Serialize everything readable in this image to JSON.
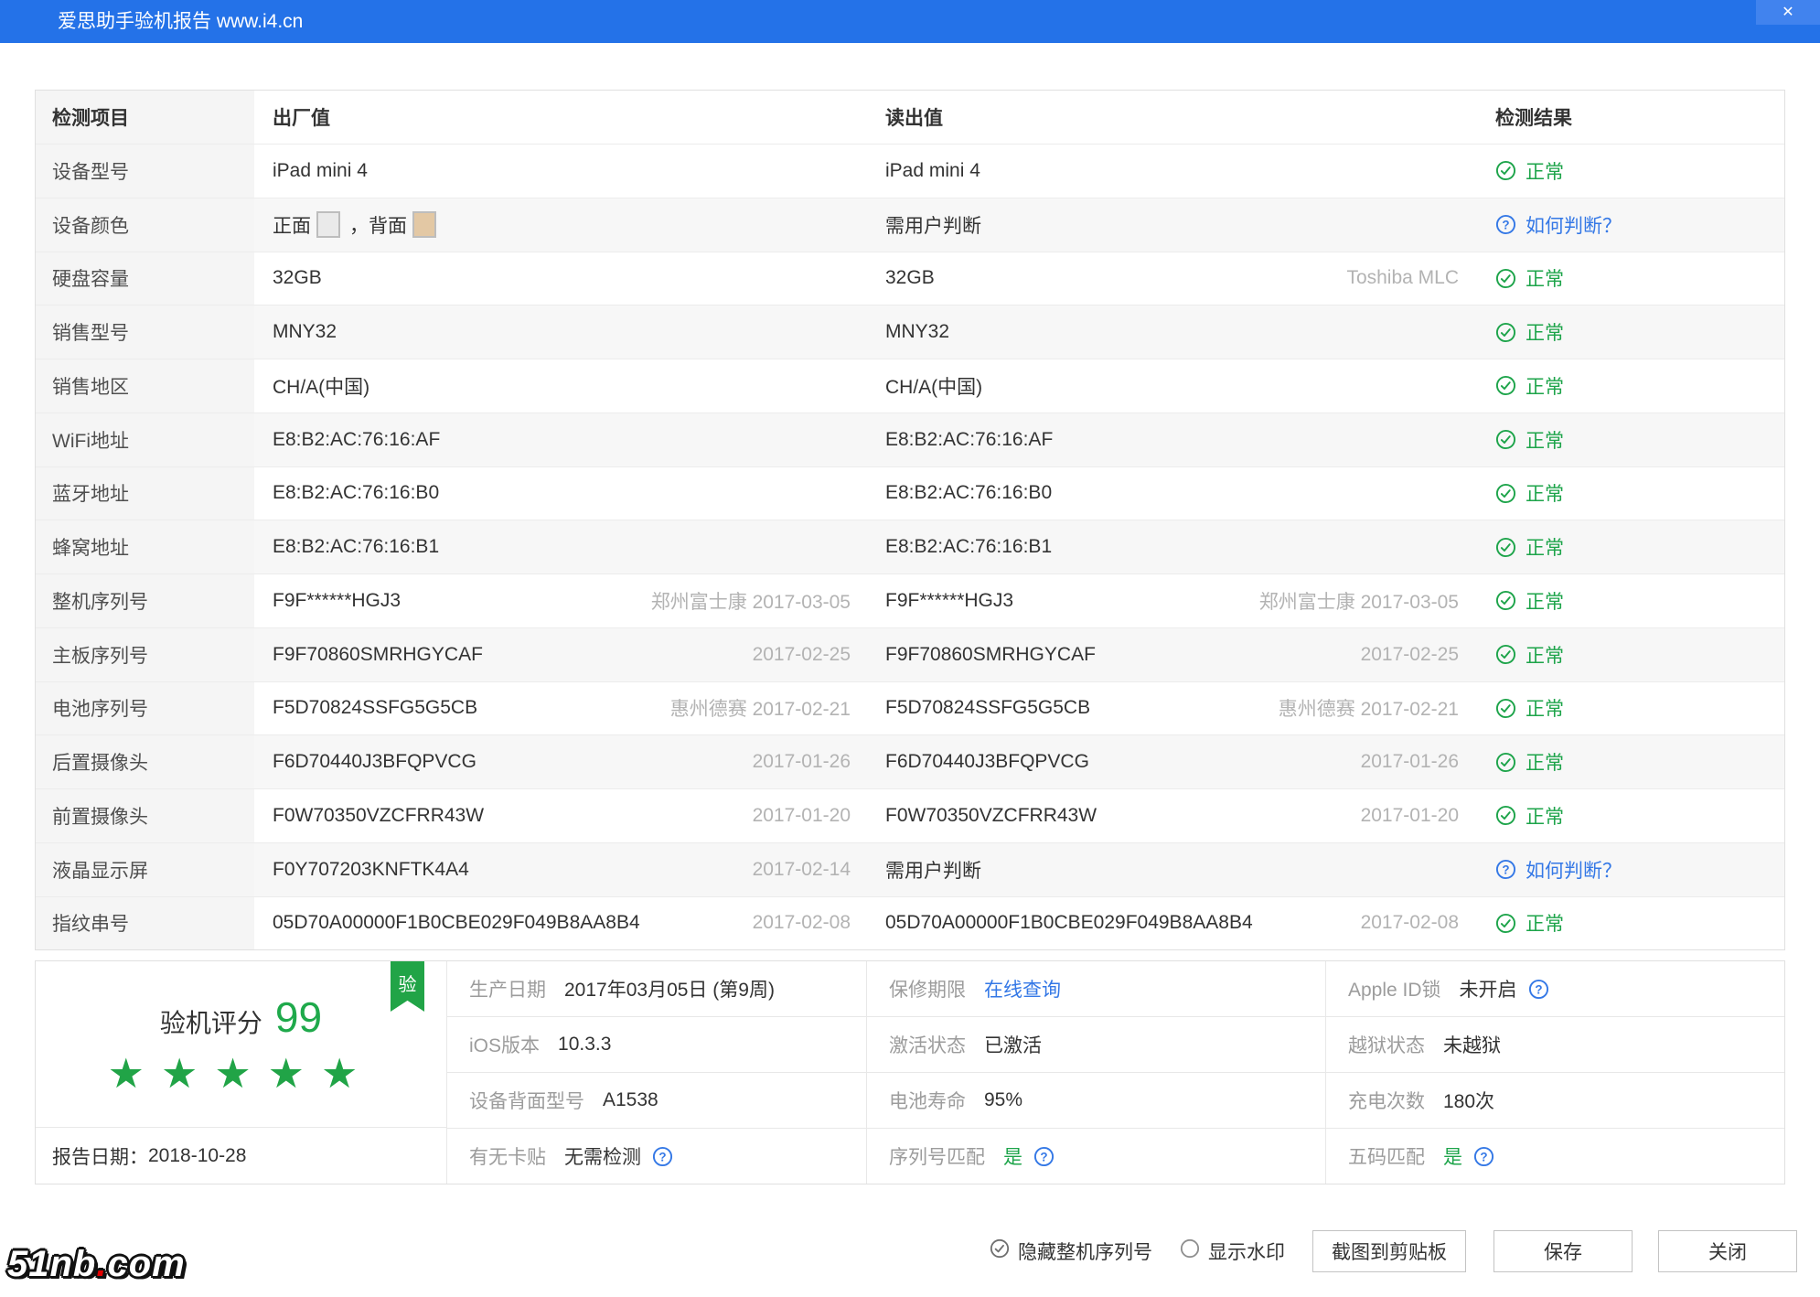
{
  "titlebar": {
    "title": "爱思助手验机报告 www.i4.cn",
    "close": "✕"
  },
  "table": {
    "headers": [
      "检测项目",
      "出厂值",
      "读出值",
      "检测结果"
    ],
    "result_labels": {
      "ok": "正常",
      "help": "如何判断？"
    },
    "rows": [
      {
        "item": "设备型号",
        "factory": {
          "text": "iPad mini 4"
        },
        "read": {
          "text": "iPad mini 4"
        },
        "result": "ok"
      },
      {
        "item": "设备颜色",
        "factory": {
          "swatches": [
            {
              "label": "正面",
              "color": "#eaeaea"
            },
            {
              "label": "，背面",
              "color": "#e3c8a4"
            }
          ]
        },
        "read": {
          "text": "需用户判断"
        },
        "result": "help"
      },
      {
        "item": "硬盘容量",
        "factory": {
          "text": "32GB"
        },
        "read": {
          "text": "32GB",
          "note": "Toshiba MLC"
        },
        "result": "ok"
      },
      {
        "item": "销售型号",
        "factory": {
          "text": "MNY32"
        },
        "read": {
          "text": "MNY32"
        },
        "result": "ok"
      },
      {
        "item": "销售地区",
        "factory": {
          "text": "CH/A(中国)"
        },
        "read": {
          "text": "CH/A(中国)"
        },
        "result": "ok"
      },
      {
        "item": "WiFi地址",
        "factory": {
          "text": "E8:B2:AC:76:16:AF"
        },
        "read": {
          "text": "E8:B2:AC:76:16:AF"
        },
        "result": "ok"
      },
      {
        "item": "蓝牙地址",
        "factory": {
          "text": "E8:B2:AC:76:16:B0"
        },
        "read": {
          "text": "E8:B2:AC:76:16:B0"
        },
        "result": "ok"
      },
      {
        "item": "蜂窝地址",
        "factory": {
          "text": "E8:B2:AC:76:16:B1"
        },
        "read": {
          "text": "E8:B2:AC:76:16:B1"
        },
        "result": "ok"
      },
      {
        "item": "整机序列号",
        "factory": {
          "text": "F9F******HGJ3",
          "note": "郑州富士康 2017-03-05"
        },
        "read": {
          "text": "F9F******HGJ3",
          "note": "郑州富士康 2017-03-05"
        },
        "result": "ok"
      },
      {
        "item": "主板序列号",
        "factory": {
          "text": "F9F70860SMRHGYCAF",
          "note": "2017-02-25"
        },
        "read": {
          "text": "F9F70860SMRHGYCAF",
          "note": "2017-02-25"
        },
        "result": "ok"
      },
      {
        "item": "电池序列号",
        "factory": {
          "text": "F5D70824SSFG5G5CB",
          "note": "惠州德赛 2017-02-21"
        },
        "read": {
          "text": "F5D70824SSFG5G5CB",
          "note": "惠州德赛 2017-02-21"
        },
        "result": "ok"
      },
      {
        "item": "后置摄像头",
        "factory": {
          "text": "F6D70440J3BFQPVCG",
          "note": "2017-01-26"
        },
        "read": {
          "text": "F6D70440J3BFQPVCG",
          "note": "2017-01-26"
        },
        "result": "ok"
      },
      {
        "item": "前置摄像头",
        "factory": {
          "text": "F0W70350VZCFRR43W",
          "note": "2017-01-20"
        },
        "read": {
          "text": "F0W70350VZCFRR43W",
          "note": "2017-01-20"
        },
        "result": "ok"
      },
      {
        "item": "液晶显示屏",
        "factory": {
          "text": "F0Y707203KNFTK4A4",
          "note": "2017-02-14"
        },
        "read": {
          "text": "需用户判断"
        },
        "result": "help"
      },
      {
        "item": "指纹串号",
        "factory": {
          "text": "05D70A00000F1B0CBE029F049B8AA8B4",
          "note": "2017-02-08"
        },
        "read": {
          "text": "05D70A00000F1B0CBE029F049B8AA8B4",
          "note": "2017-02-08"
        },
        "result": "ok"
      }
    ]
  },
  "score_panel": {
    "badge": "验",
    "score_label": "验机评分",
    "score": "99",
    "stars": 5,
    "star_char": "★",
    "report_date_label": "报告日期：",
    "report_date": "2018-10-28"
  },
  "info": {
    "columns": [
      {
        "cells": [
          {
            "label": "生产日期",
            "value": "2017年03月05日 (第9周)"
          },
          {
            "label": "iOS版本",
            "value": "10.3.3"
          },
          {
            "label": "设备背面型号",
            "value": "A1538"
          },
          {
            "label": "有无卡贴",
            "value": "无需检测",
            "help": true
          }
        ]
      },
      {
        "cells": [
          {
            "label": "保修期限",
            "value": "在线查询",
            "style": "link"
          },
          {
            "label": "激活状态",
            "value": "已激活"
          },
          {
            "label": "电池寿命",
            "value": "95%"
          },
          {
            "label": "序列号匹配",
            "value": "是",
            "style": "green",
            "help": true
          }
        ]
      },
      {
        "cells": [
          {
            "label": "Apple ID锁",
            "value": "未开启",
            "help": true
          },
          {
            "label": "越狱状态",
            "value": "未越狱"
          },
          {
            "label": "充电次数",
            "value": "180次"
          },
          {
            "label": "五码匹配",
            "value": "是",
            "style": "green",
            "help": true
          }
        ]
      }
    ]
  },
  "footer": {
    "hide_serial_label": "隐藏整机序列号",
    "show_watermark_label": "显示水印",
    "screenshot_button": "截图到剪贴板",
    "save_button": "保存",
    "close_button": "关闭"
  },
  "watermark": {
    "pre": "51nb",
    "dot": ".",
    "post": "com"
  },
  "colors": {
    "green": "#1da44a",
    "blue": "#3478e6",
    "footer_gray": "#6f6f6f",
    "titlebar_blue": "#2472e8"
  }
}
